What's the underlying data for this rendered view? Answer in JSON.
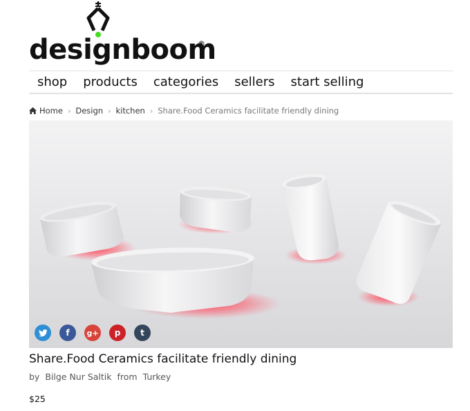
{
  "brand": {
    "name": "designboom",
    "registered_mark": "®"
  },
  "nav": {
    "items": [
      {
        "label": "shop"
      },
      {
        "label": "products"
      },
      {
        "label": "categories"
      },
      {
        "label": "sellers"
      },
      {
        "label": "start selling"
      }
    ]
  },
  "breadcrumb": {
    "home": "Home",
    "items": [
      {
        "label": "Design"
      },
      {
        "label": "kitchen"
      }
    ],
    "current": "Share.Food Ceramics facilitate friendly dining"
  },
  "social": {
    "buttons": [
      {
        "icon": "twitter-icon",
        "glyph": "t",
        "color": "#2f8fd6"
      },
      {
        "icon": "facebook-icon",
        "glyph": "f",
        "color": "#3b5998"
      },
      {
        "icon": "google-plus-icon",
        "glyph": "g+",
        "color": "#d9443a"
      },
      {
        "icon": "pinterest-icon",
        "glyph": "p",
        "color": "#cc2127"
      },
      {
        "icon": "tumblr-icon",
        "glyph": "t",
        "color": "#35465c"
      }
    ]
  },
  "product": {
    "title": "Share.Food Ceramics facilitate friendly dining",
    "by_label": "by",
    "seller": "Bilge Nur Saltik",
    "from_label": "from",
    "country": "Turkey",
    "price": "$25"
  },
  "colors": {
    "accent_green": "#44dd22",
    "glow_red": "#ff4a5a"
  }
}
